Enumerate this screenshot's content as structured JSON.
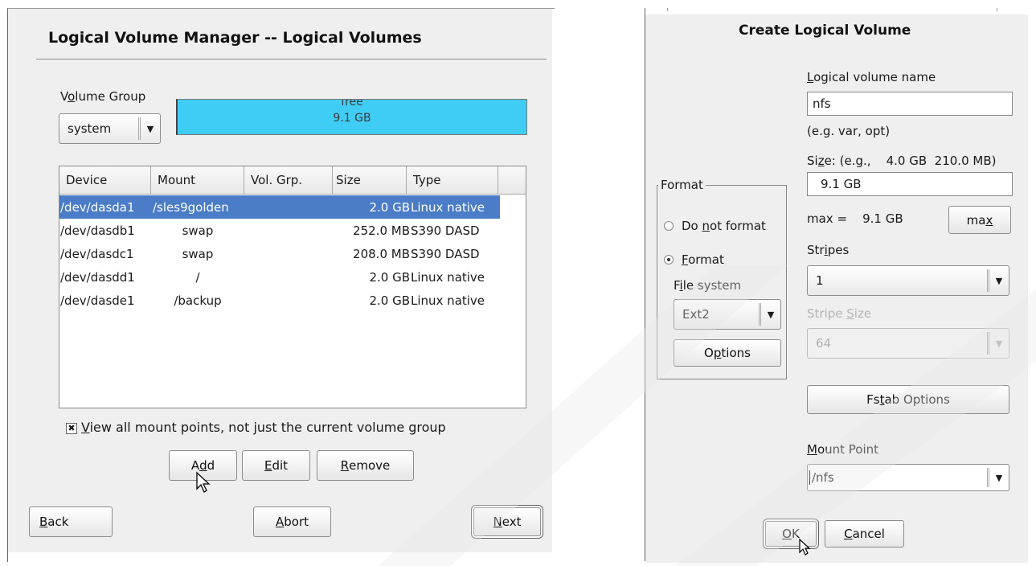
{
  "left": {
    "title": "Logical Volume Manager -- Logical Volumes",
    "volume_group_label": {
      "pre": "V",
      "acc": "o",
      "post": "lume Group"
    },
    "volume_group_value": "system",
    "free_bar": {
      "label": "free",
      "size": "9.1 GB",
      "color": "#40cdf5"
    },
    "table": {
      "headers": [
        "Device",
        "Mount",
        "Vol. Grp.",
        "Size",
        "Type"
      ],
      "rows": [
        {
          "device": "/dev/dasda1",
          "mount": "/sles9golden",
          "vg": "",
          "size": "2.0 GB",
          "type": "Linux native",
          "selected": true
        },
        {
          "device": "/dev/dasdb1",
          "mount": "swap",
          "vg": "",
          "size": "252.0 MB",
          "type": "S390 DASD",
          "selected": false
        },
        {
          "device": "/dev/dasdc1",
          "mount": "swap",
          "vg": "",
          "size": "208.0 MB",
          "type": "S390 DASD",
          "selected": false
        },
        {
          "device": "/dev/dasdd1",
          "mount": "/",
          "vg": "",
          "size": "2.0 GB",
          "type": "Linux native",
          "selected": false
        },
        {
          "device": "/dev/dasde1",
          "mount": "/backup",
          "vg": "",
          "size": "2.0 GB",
          "type": "Linux native",
          "selected": false
        }
      ]
    },
    "view_all": {
      "checked": true,
      "pre": "",
      "acc": "V",
      "post": "iew all mount points, not just the current volume group"
    },
    "add": {
      "pre": "A",
      "acc": "d",
      "post": "d"
    },
    "edit": {
      "pre": "",
      "acc": "E",
      "post": "dit"
    },
    "remove": {
      "pre": "",
      "acc": "R",
      "post": "emove"
    },
    "back": {
      "pre": "",
      "acc": "B",
      "post": "ack"
    },
    "abort": {
      "pre": "",
      "acc": "A",
      "post": "bort"
    },
    "next": {
      "pre": "",
      "acc": "N",
      "post": "ext"
    }
  },
  "right": {
    "title": "Create Logical Volume",
    "lv_name_label": {
      "pre": "",
      "acc": "L",
      "post": "ogical volume name"
    },
    "lv_name_value": "nfs",
    "lv_name_hint": "(e.g. var, opt)",
    "size_label": {
      "pre": "Si",
      "acc": "z",
      "post": "e: (e.g.,    4.0 GB  210.0 MB)"
    },
    "size_value": "9.1 GB",
    "max_text": "max =    9.1 GB",
    "max_button": {
      "pre": "ma",
      "acc": "x",
      "post": ""
    },
    "format_group": "Format",
    "do_not_format": {
      "pre": "Do ",
      "acc": "n",
      "post": "ot format",
      "selected": false
    },
    "format": {
      "pre": "",
      "acc": "F",
      "post": "ormat",
      "selected": true
    },
    "file_system_label": {
      "pre": "F",
      "acc": "i",
      "post": "le system"
    },
    "file_system_value": "Ext2",
    "options": {
      "pre": "O",
      "acc": "p",
      "post": "tions"
    },
    "stripes_label": {
      "pre": "Str",
      "acc": "i",
      "post": "pes"
    },
    "stripes_value": "1",
    "stripe_size_label": {
      "pre": "Stripe ",
      "acc": "S",
      "post": "ize"
    },
    "stripe_size_value": "64",
    "fstab_options": {
      "pre": "Fs",
      "acc": "t",
      "post": "ab Options"
    },
    "mount_point_label": {
      "pre": "",
      "acc": "M",
      "post": "ount Point"
    },
    "mount_point_value": "/nfs",
    "ok": {
      "pre": "",
      "acc": "O",
      "post": "K"
    },
    "cancel": {
      "pre": "",
      "acc": "C",
      "post": "ancel"
    }
  }
}
